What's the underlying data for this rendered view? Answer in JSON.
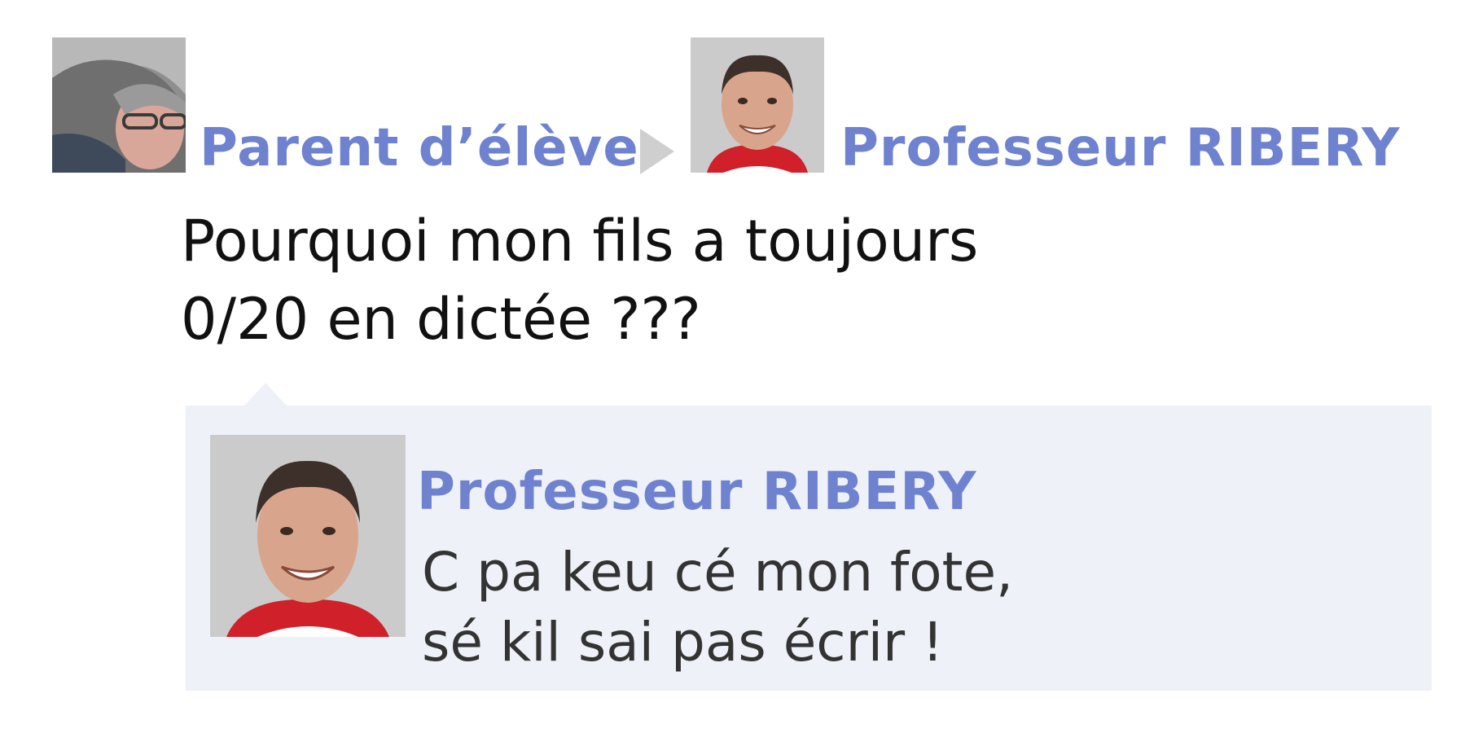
{
  "post": {
    "author": "Parent d’élève",
    "recipient": "Professeur RIBERY",
    "message_lines": [
      "Pourquoi mon fils a toujours",
      "0/20 en dictée ???"
    ]
  },
  "reply": {
    "author": "Professeur RIBERY",
    "message_lines": [
      "C pa keu cé mon fote,",
      "sé kil sai pas écrir !"
    ]
  },
  "icons": {
    "arrow": "triangle-right-icon"
  },
  "colors": {
    "name": "#6e82cf",
    "message_text": "#111111",
    "reply_text": "#333333",
    "reply_background": "#eef1f8",
    "arrow": "#cfcfcf"
  }
}
